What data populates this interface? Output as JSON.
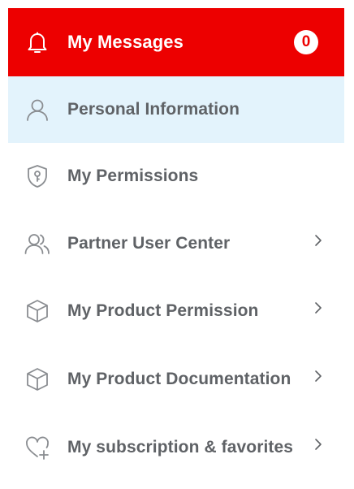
{
  "menu": {
    "messages": {
      "label": "My Messages",
      "badge_count": "0",
      "icon": "bell-icon",
      "bg_color": "#ed0000"
    },
    "items": [
      {
        "label": "Personal Information",
        "icon": "user-icon",
        "selected": true,
        "has_submenu": false
      },
      {
        "label": "My Permissions",
        "icon": "shield-key-icon",
        "selected": false,
        "has_submenu": false
      },
      {
        "label": "Partner User Center",
        "icon": "users-icon",
        "selected": false,
        "has_submenu": true
      },
      {
        "label": "My Product Permission",
        "icon": "cube-icon",
        "selected": false,
        "has_submenu": true
      },
      {
        "label": "My Product Documentation",
        "icon": "cube-icon",
        "selected": false,
        "has_submenu": true
      },
      {
        "label": "My subscription & favorites",
        "icon": "heart-plus-icon",
        "selected": false,
        "has_submenu": true
      }
    ],
    "colors": {
      "accent": "#ed0000",
      "selected_bg": "#e3f3fc",
      "text": "#5f6266",
      "icon": "#8a8d91"
    }
  }
}
